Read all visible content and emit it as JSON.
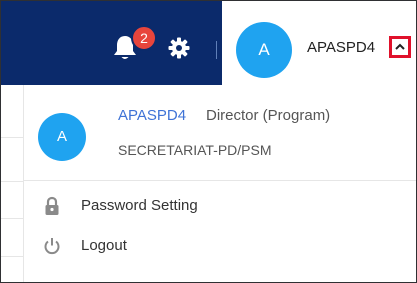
{
  "header": {
    "notification_count": "2",
    "user_initial": "A",
    "username": "APASPD4"
  },
  "profile": {
    "initial": "A",
    "name": "APASPD4",
    "role": "Director (Program)",
    "department": "SECRETARIAT-PD/PSM"
  },
  "menu": {
    "items": [
      {
        "label": "Password Setting",
        "icon": "lock-icon"
      },
      {
        "label": "Logout",
        "icon": "power-icon"
      }
    ]
  },
  "colors": {
    "header_bg": "#0b2a6b",
    "avatar": "#1fa3f0",
    "badge": "#e8453c",
    "highlight": "#e0112b",
    "link": "#3f73d6"
  }
}
